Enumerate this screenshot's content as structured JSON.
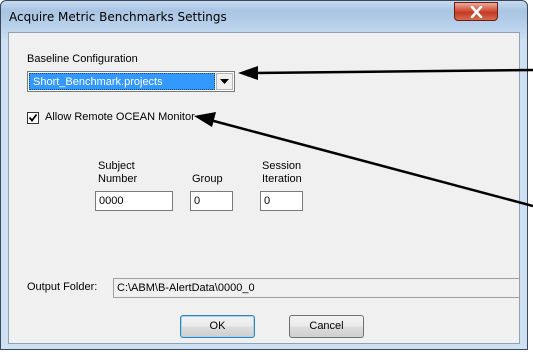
{
  "window": {
    "title": "Acquire Metric Benchmarks Settings"
  },
  "baseline": {
    "label": "Baseline Configuration",
    "selected": "Short_Benchmark.projects"
  },
  "remote_monitor": {
    "label": "Allow Remote OCEAN Monitor",
    "checked": true
  },
  "fields": {
    "subject_line1": "Subject",
    "subject_line2": "Number",
    "subject_value": "0000",
    "group_label": "Group",
    "group_value": "0",
    "session_line1": "Session",
    "session_line2": "Iteration",
    "session_value": "0"
  },
  "output": {
    "label": "Output Folder:",
    "value": "C:\\ABM\\B-AlertData\\0000_0"
  },
  "buttons": {
    "ok": "OK",
    "cancel": "Cancel"
  },
  "icons": {
    "close": "close-icon",
    "dropdown": "chevron-down-icon",
    "check": "check-icon"
  }
}
